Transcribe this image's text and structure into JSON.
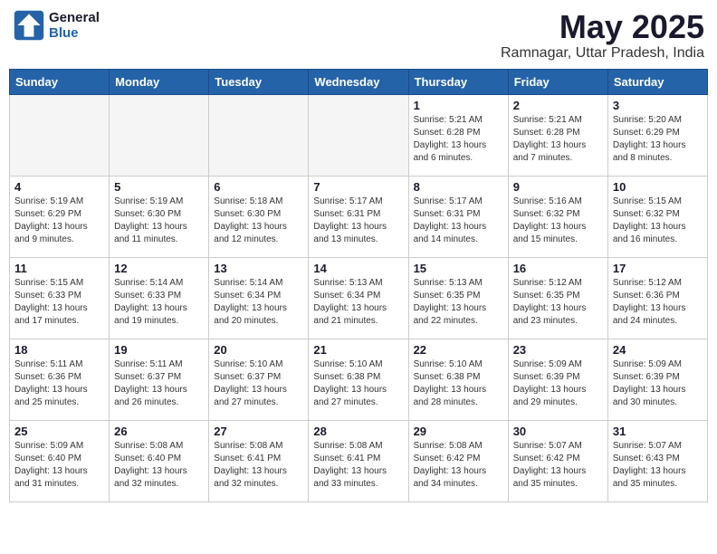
{
  "logo": {
    "line1": "General",
    "line2": "Blue"
  },
  "title": "May 2025",
  "location": "Ramnagar, Uttar Pradesh, India",
  "weekdays": [
    "Sunday",
    "Monday",
    "Tuesday",
    "Wednesday",
    "Thursday",
    "Friday",
    "Saturday"
  ],
  "weeks": [
    [
      {
        "day": "",
        "info": ""
      },
      {
        "day": "",
        "info": ""
      },
      {
        "day": "",
        "info": ""
      },
      {
        "day": "",
        "info": ""
      },
      {
        "day": "1",
        "info": "Sunrise: 5:21 AM\nSunset: 6:28 PM\nDaylight: 13 hours\nand 6 minutes."
      },
      {
        "day": "2",
        "info": "Sunrise: 5:21 AM\nSunset: 6:28 PM\nDaylight: 13 hours\nand 7 minutes."
      },
      {
        "day": "3",
        "info": "Sunrise: 5:20 AM\nSunset: 6:29 PM\nDaylight: 13 hours\nand 8 minutes."
      }
    ],
    [
      {
        "day": "4",
        "info": "Sunrise: 5:19 AM\nSunset: 6:29 PM\nDaylight: 13 hours\nand 9 minutes."
      },
      {
        "day": "5",
        "info": "Sunrise: 5:19 AM\nSunset: 6:30 PM\nDaylight: 13 hours\nand 11 minutes."
      },
      {
        "day": "6",
        "info": "Sunrise: 5:18 AM\nSunset: 6:30 PM\nDaylight: 13 hours\nand 12 minutes."
      },
      {
        "day": "7",
        "info": "Sunrise: 5:17 AM\nSunset: 6:31 PM\nDaylight: 13 hours\nand 13 minutes."
      },
      {
        "day": "8",
        "info": "Sunrise: 5:17 AM\nSunset: 6:31 PM\nDaylight: 13 hours\nand 14 minutes."
      },
      {
        "day": "9",
        "info": "Sunrise: 5:16 AM\nSunset: 6:32 PM\nDaylight: 13 hours\nand 15 minutes."
      },
      {
        "day": "10",
        "info": "Sunrise: 5:15 AM\nSunset: 6:32 PM\nDaylight: 13 hours\nand 16 minutes."
      }
    ],
    [
      {
        "day": "11",
        "info": "Sunrise: 5:15 AM\nSunset: 6:33 PM\nDaylight: 13 hours\nand 17 minutes."
      },
      {
        "day": "12",
        "info": "Sunrise: 5:14 AM\nSunset: 6:33 PM\nDaylight: 13 hours\nand 19 minutes."
      },
      {
        "day": "13",
        "info": "Sunrise: 5:14 AM\nSunset: 6:34 PM\nDaylight: 13 hours\nand 20 minutes."
      },
      {
        "day": "14",
        "info": "Sunrise: 5:13 AM\nSunset: 6:34 PM\nDaylight: 13 hours\nand 21 minutes."
      },
      {
        "day": "15",
        "info": "Sunrise: 5:13 AM\nSunset: 6:35 PM\nDaylight: 13 hours\nand 22 minutes."
      },
      {
        "day": "16",
        "info": "Sunrise: 5:12 AM\nSunset: 6:35 PM\nDaylight: 13 hours\nand 23 minutes."
      },
      {
        "day": "17",
        "info": "Sunrise: 5:12 AM\nSunset: 6:36 PM\nDaylight: 13 hours\nand 24 minutes."
      }
    ],
    [
      {
        "day": "18",
        "info": "Sunrise: 5:11 AM\nSunset: 6:36 PM\nDaylight: 13 hours\nand 25 minutes."
      },
      {
        "day": "19",
        "info": "Sunrise: 5:11 AM\nSunset: 6:37 PM\nDaylight: 13 hours\nand 26 minutes."
      },
      {
        "day": "20",
        "info": "Sunrise: 5:10 AM\nSunset: 6:37 PM\nDaylight: 13 hours\nand 27 minutes."
      },
      {
        "day": "21",
        "info": "Sunrise: 5:10 AM\nSunset: 6:38 PM\nDaylight: 13 hours\nand 27 minutes."
      },
      {
        "day": "22",
        "info": "Sunrise: 5:10 AM\nSunset: 6:38 PM\nDaylight: 13 hours\nand 28 minutes."
      },
      {
        "day": "23",
        "info": "Sunrise: 5:09 AM\nSunset: 6:39 PM\nDaylight: 13 hours\nand 29 minutes."
      },
      {
        "day": "24",
        "info": "Sunrise: 5:09 AM\nSunset: 6:39 PM\nDaylight: 13 hours\nand 30 minutes."
      }
    ],
    [
      {
        "day": "25",
        "info": "Sunrise: 5:09 AM\nSunset: 6:40 PM\nDaylight: 13 hours\nand 31 minutes."
      },
      {
        "day": "26",
        "info": "Sunrise: 5:08 AM\nSunset: 6:40 PM\nDaylight: 13 hours\nand 32 minutes."
      },
      {
        "day": "27",
        "info": "Sunrise: 5:08 AM\nSunset: 6:41 PM\nDaylight: 13 hours\nand 32 minutes."
      },
      {
        "day": "28",
        "info": "Sunrise: 5:08 AM\nSunset: 6:41 PM\nDaylight: 13 hours\nand 33 minutes."
      },
      {
        "day": "29",
        "info": "Sunrise: 5:08 AM\nSunset: 6:42 PM\nDaylight: 13 hours\nand 34 minutes."
      },
      {
        "day": "30",
        "info": "Sunrise: 5:07 AM\nSunset: 6:42 PM\nDaylight: 13 hours\nand 35 minutes."
      },
      {
        "day": "31",
        "info": "Sunrise: 5:07 AM\nSunset: 6:43 PM\nDaylight: 13 hours\nand 35 minutes."
      }
    ]
  ]
}
